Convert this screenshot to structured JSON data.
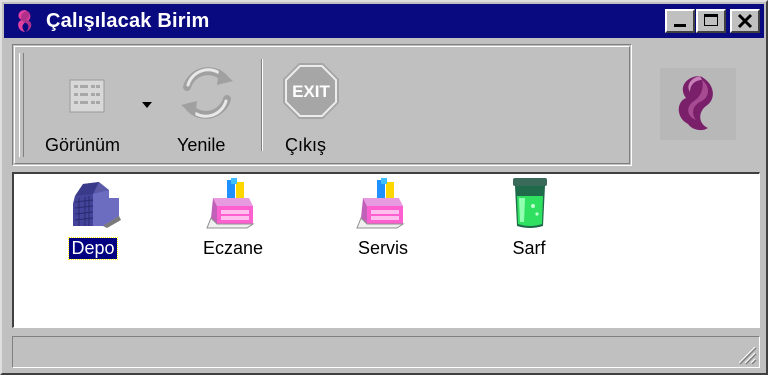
{
  "window": {
    "title": "Çalışılacak Birim"
  },
  "toolbar": {
    "view_label": "Görünüm",
    "refresh_label": "Yenile",
    "exit_label": "Çıkış",
    "exit_icon_text": "EXIT"
  },
  "items": [
    {
      "label": "Depo",
      "icon": "warehouse-icon",
      "selected": true
    },
    {
      "label": "Eczane",
      "icon": "cash-register-icon",
      "selected": false
    },
    {
      "label": "Servis",
      "icon": "cash-register-icon",
      "selected": false
    },
    {
      "label": "Sarf",
      "icon": "beaker-icon",
      "selected": false
    }
  ],
  "colors": {
    "titlebar": "#0a0a80",
    "face": "#c0c0c0",
    "logo": "#7a1f6a",
    "selection": "#000080"
  }
}
